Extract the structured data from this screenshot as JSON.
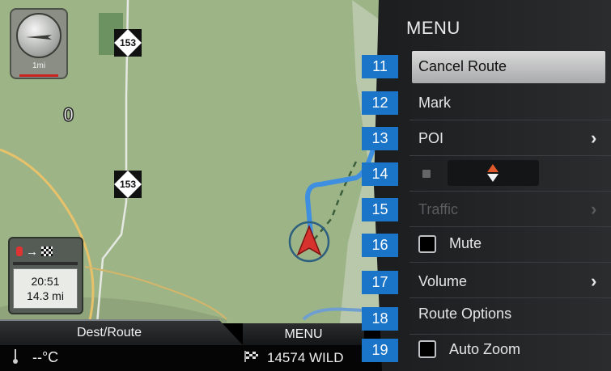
{
  "map": {
    "scale_label": "1mi",
    "route_shields": [
      "153",
      "153"
    ],
    "zero_label": "0",
    "trip": {
      "time": "20:51",
      "distance": "14.3 mi",
      "icons": [
        "destination-red-icon",
        "arrow-right-icon",
        "checkered-flag-icon"
      ]
    }
  },
  "bottom": {
    "dest_route_tab": "Dest/Route",
    "menu_tab": "MENU",
    "temperature": "--°C",
    "destination": "14574 WILD"
  },
  "menu": {
    "title": "MENU",
    "items": [
      {
        "num": "11",
        "label": "Cancel Route",
        "type": "button",
        "active": true
      },
      {
        "num": "12",
        "label": "Mark",
        "type": "button"
      },
      {
        "num": "13",
        "label": "POI",
        "type": "submenu"
      },
      {
        "num": "14",
        "label": "",
        "type": "mode-toggle"
      },
      {
        "num": "15",
        "label": "Traffic",
        "type": "submenu",
        "disabled": true
      },
      {
        "num": "16",
        "label": "Mute",
        "type": "checkbox",
        "checked": false
      },
      {
        "num": "17",
        "label": "Volume",
        "type": "submenu"
      },
      {
        "num": "18",
        "label": "Route Options",
        "type": "button"
      },
      {
        "num": "19",
        "label": "Auto Zoom",
        "type": "checkbox",
        "checked": false
      }
    ]
  },
  "colors": {
    "map_green": "#9db487",
    "route_blue": "#3f8fe0",
    "label_blue": "#1a74c7",
    "highlight": "#c8c9cb",
    "vehicle_red": "#d8322e"
  }
}
